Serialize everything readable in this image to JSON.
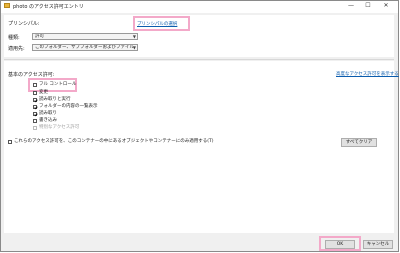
{
  "window": {
    "title": "photo のアクセス許可エントリ",
    "controls": {
      "minimize": "—",
      "maximize": "☐",
      "close": "✕"
    }
  },
  "principal": {
    "label": "プリンシパル:",
    "select_link": "プリンシパルの選択"
  },
  "type": {
    "label": "種類:",
    "value": "許可"
  },
  "applies_to": {
    "label": "適用先:",
    "value": "このフォルダー、サブフォルダーおよびファイル"
  },
  "basic_permissions": {
    "label": "基本のアクセス許可:",
    "advanced_link": "高度なアクセス許可を表示する",
    "items": [
      {
        "label": "フル コントロール",
        "checked": false,
        "disabled": false
      },
      {
        "label": "変更",
        "checked": false,
        "disabled": false
      },
      {
        "label": "読み取りと実行",
        "checked": true,
        "disabled": false
      },
      {
        "label": "フォルダーの内容の一覧表示",
        "checked": true,
        "disabled": false
      },
      {
        "label": "読み取り",
        "checked": true,
        "disabled": false
      },
      {
        "label": "書き込み",
        "checked": false,
        "disabled": false
      },
      {
        "label": "特別なアクセス許可",
        "checked": false,
        "disabled": true
      }
    ]
  },
  "apply_only_container": {
    "label": "これらのアクセス許可を、このコンテナーの中にあるオブジェクトやコンテナーにのみ適用する(T)",
    "checked": false
  },
  "clear_all_button": "すべてクリア",
  "ok_button": "OK",
  "cancel_button": "キャンセル",
  "colors": {
    "highlight": "#f3a9c9",
    "link": "#0b5cad"
  }
}
